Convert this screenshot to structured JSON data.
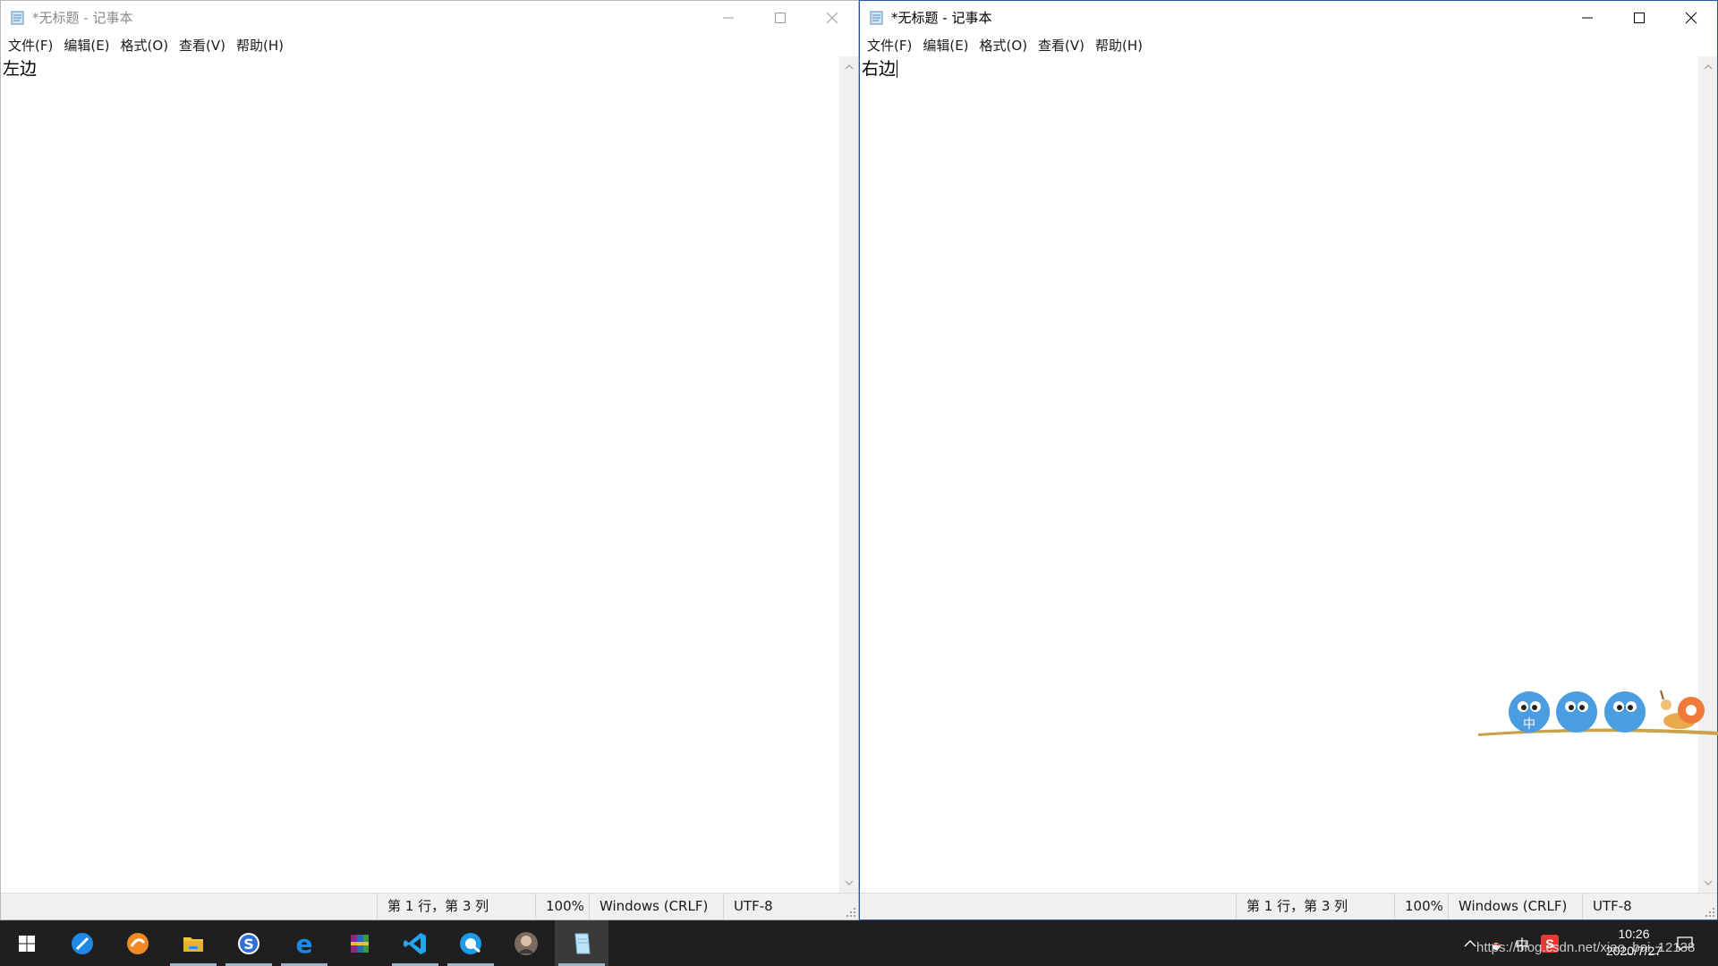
{
  "left_window": {
    "title": "*无标题 - 记事本",
    "menu": [
      "文件(F)",
      "编辑(E)",
      "格式(O)",
      "查看(V)",
      "帮助(H)"
    ],
    "content": "左边",
    "status": {
      "position": "第 1 行，第 3 列",
      "zoom": "100%",
      "line_ending": "Windows (CRLF)",
      "encoding": "UTF-8"
    }
  },
  "right_window": {
    "title": "*无标题 - 记事本",
    "menu": [
      "文件(F)",
      "编辑(E)",
      "格式(O)",
      "查看(V)",
      "帮助(H)"
    ],
    "content": "右边",
    "status": {
      "position": "第 1 行，第 3 列",
      "zoom": "100%",
      "line_ending": "Windows (CRLF)",
      "encoding": "UTF-8"
    }
  },
  "taskbar": {
    "apps": [
      "start-icon",
      "browser-icon",
      "media-player-icon",
      "file-explorer-icon",
      "sogou-icon",
      "edge-icon",
      "winrar-icon",
      "vscode-icon",
      "qq-browser-icon",
      "avatar-app-icon",
      "notepad-icon"
    ],
    "tray": {
      "ime_label": "中",
      "sogou_label": "S",
      "time": "10:26",
      "date": "2020/7/27"
    },
    "watermark": "https://blog.csdn.net/xiao_bai_12138"
  },
  "colors": {
    "accent": "#2b579a",
    "taskbar": "#1f1f1f",
    "statusbar": "#f0f0f0"
  }
}
